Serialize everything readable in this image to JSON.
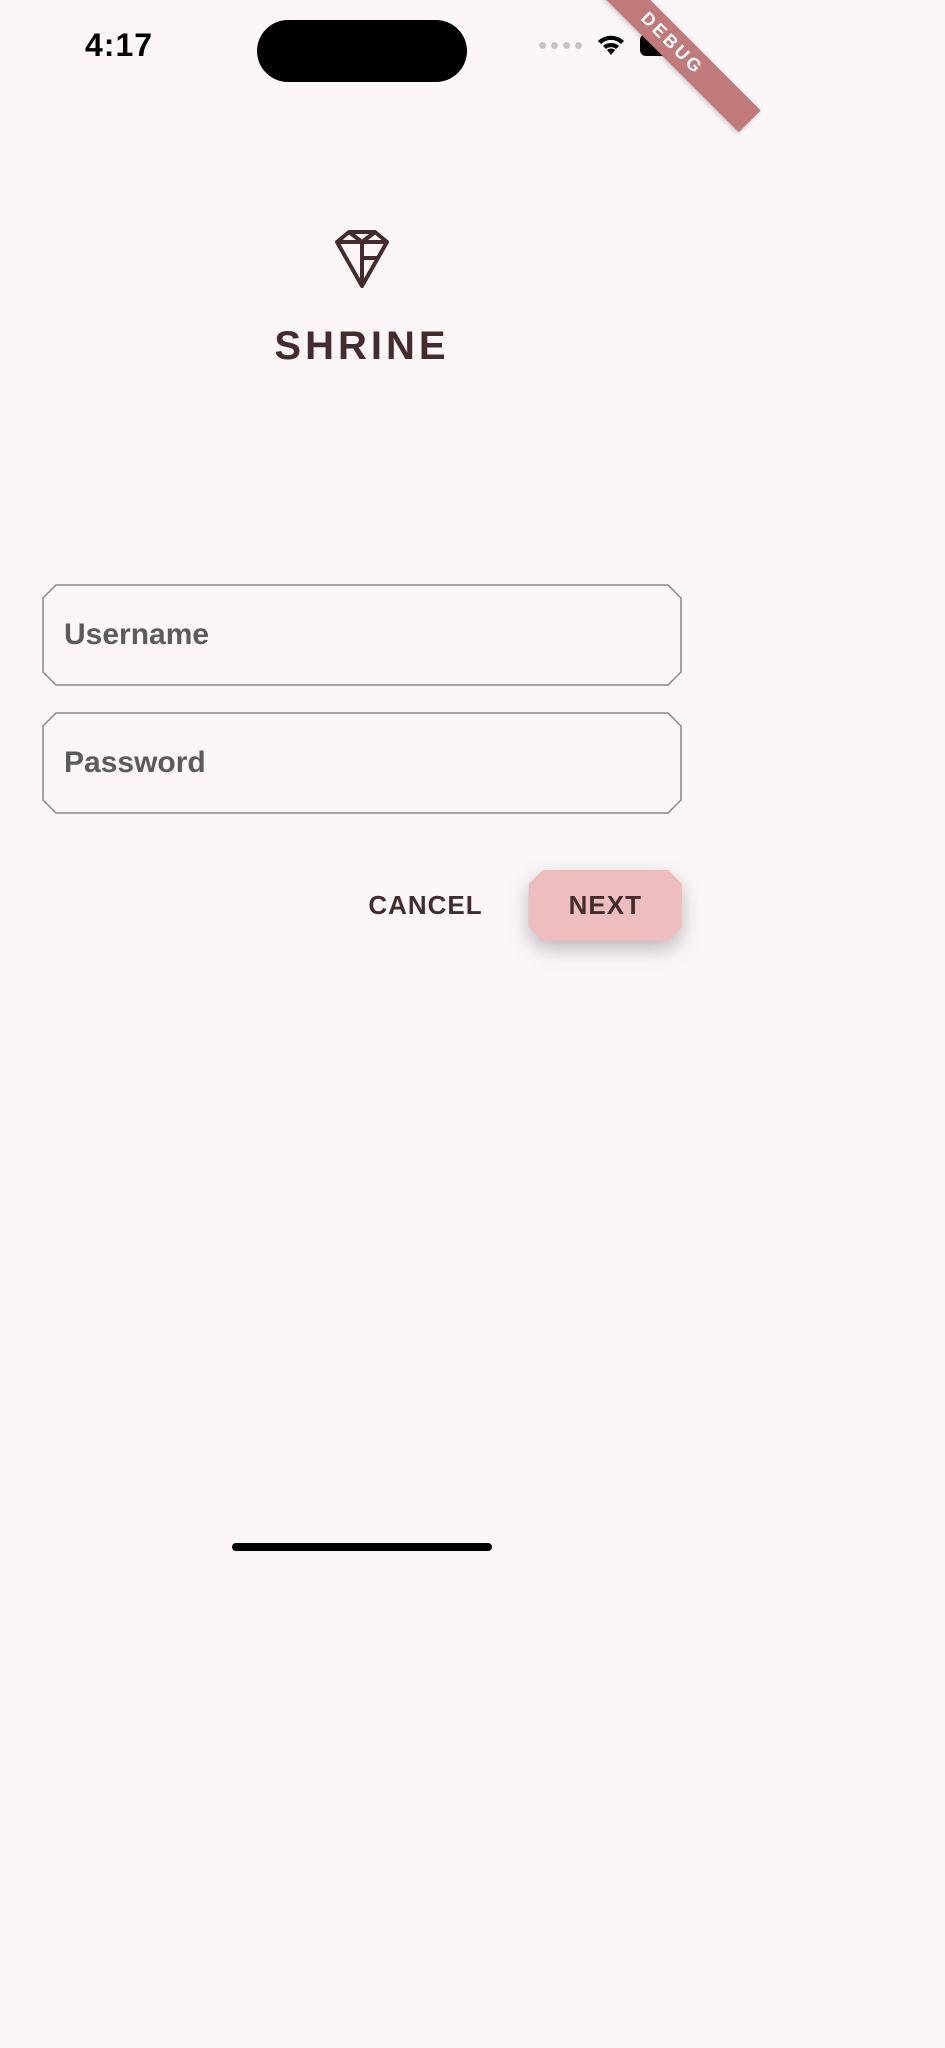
{
  "status": {
    "time": "4:17",
    "debug_label": "DEBUG"
  },
  "logo": {
    "app_name": "SHRINE"
  },
  "form": {
    "username_placeholder": "Username",
    "username_value": "",
    "password_placeholder": "Password",
    "password_value": ""
  },
  "buttons": {
    "cancel": "CANCEL",
    "next": "NEXT"
  },
  "colors": {
    "background": "#fdf6f9",
    "text_primary": "#442c2e",
    "accent": "#eebdbd",
    "debug_banner": "#c07a7a"
  }
}
